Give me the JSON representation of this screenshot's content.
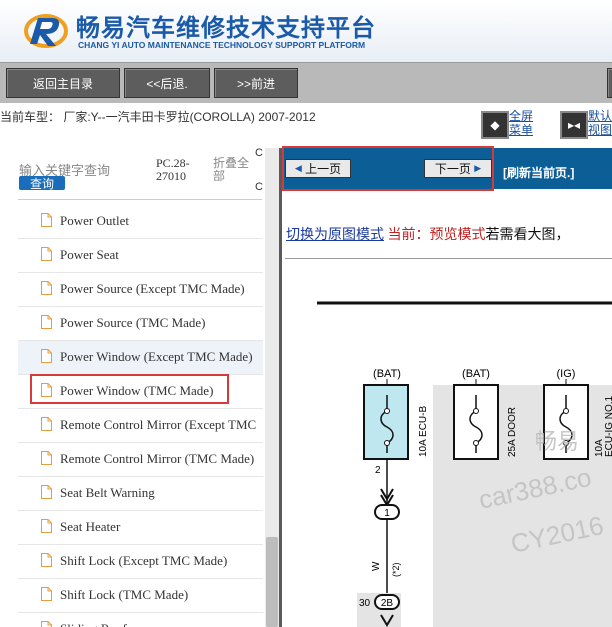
{
  "header": {
    "title": "畅易汽车维修技术支持平台",
    "subtitle": "CHANG YI AUTO MAINTENANCE TECHNOLOGY SUPPORT PLATFORM"
  },
  "toolbar": {
    "main_menu": "返回主目录",
    "back": "<<后退.",
    "forward": ">>前进"
  },
  "vehicle": {
    "text": "当前车型：  厂家:Y--一汽丰田卡罗拉(COROLLA) 2007-2012",
    "fullscreen_label_1": "全屏",
    "fullscreen_label_2": "菜单",
    "default_label_1": "默认",
    "default_label_2": "视图"
  },
  "search": {
    "hint": "输入关键字查询",
    "button": "查询",
    "code_1": "PC.28-",
    "code_2": "27010",
    "collapse_1": "折叠全",
    "collapse_2": "部",
    "c_mark": "C"
  },
  "tree": {
    "items": [
      {
        "label": "Power Outlet"
      },
      {
        "label": "Power Seat"
      },
      {
        "label": "Power Source (Except TMC Made)"
      },
      {
        "label": "Power Source (TMC Made)"
      },
      {
        "label": "Power Window (Except TMC Made)"
      },
      {
        "label": "Power Window (TMC Made)"
      },
      {
        "label": "Remote Control Mirror (Except TMC"
      },
      {
        "label": "Remote Control Mirror (TMC Made)"
      },
      {
        "label": "Seat Belt Warning"
      },
      {
        "label": "Seat Heater"
      },
      {
        "label": "Shift Lock (Except TMC Made)"
      },
      {
        "label": "Shift Lock (TMC Made)"
      },
      {
        "label": "Sliding Roof"
      }
    ],
    "selected_index": 5
  },
  "pager": {
    "prev": "上一页",
    "next": "下一页",
    "refresh": "[刷新当前页.]"
  },
  "mode": {
    "switch_link": "切换为原图模式",
    "current": " 当前：预览模式",
    "rest": "若需看大图，"
  },
  "diagram": {
    "top_labels": [
      "(BAT)",
      "(BAT)",
      "(IG)"
    ],
    "fuse_1": "10A ECU-B",
    "fuse_2": "25A DOOR",
    "fuse_3": "10A",
    "fuse_3b": "ECU-IG NO.1",
    "pin_2": "2",
    "conn_1": "1",
    "wire_w": "W",
    "wire_note": "(*2)",
    "pin_30": "30",
    "conn_2b": "2B",
    "watermark_1": "畅易",
    "watermark_2": "car388.co",
    "watermark_3": "CY2016"
  }
}
